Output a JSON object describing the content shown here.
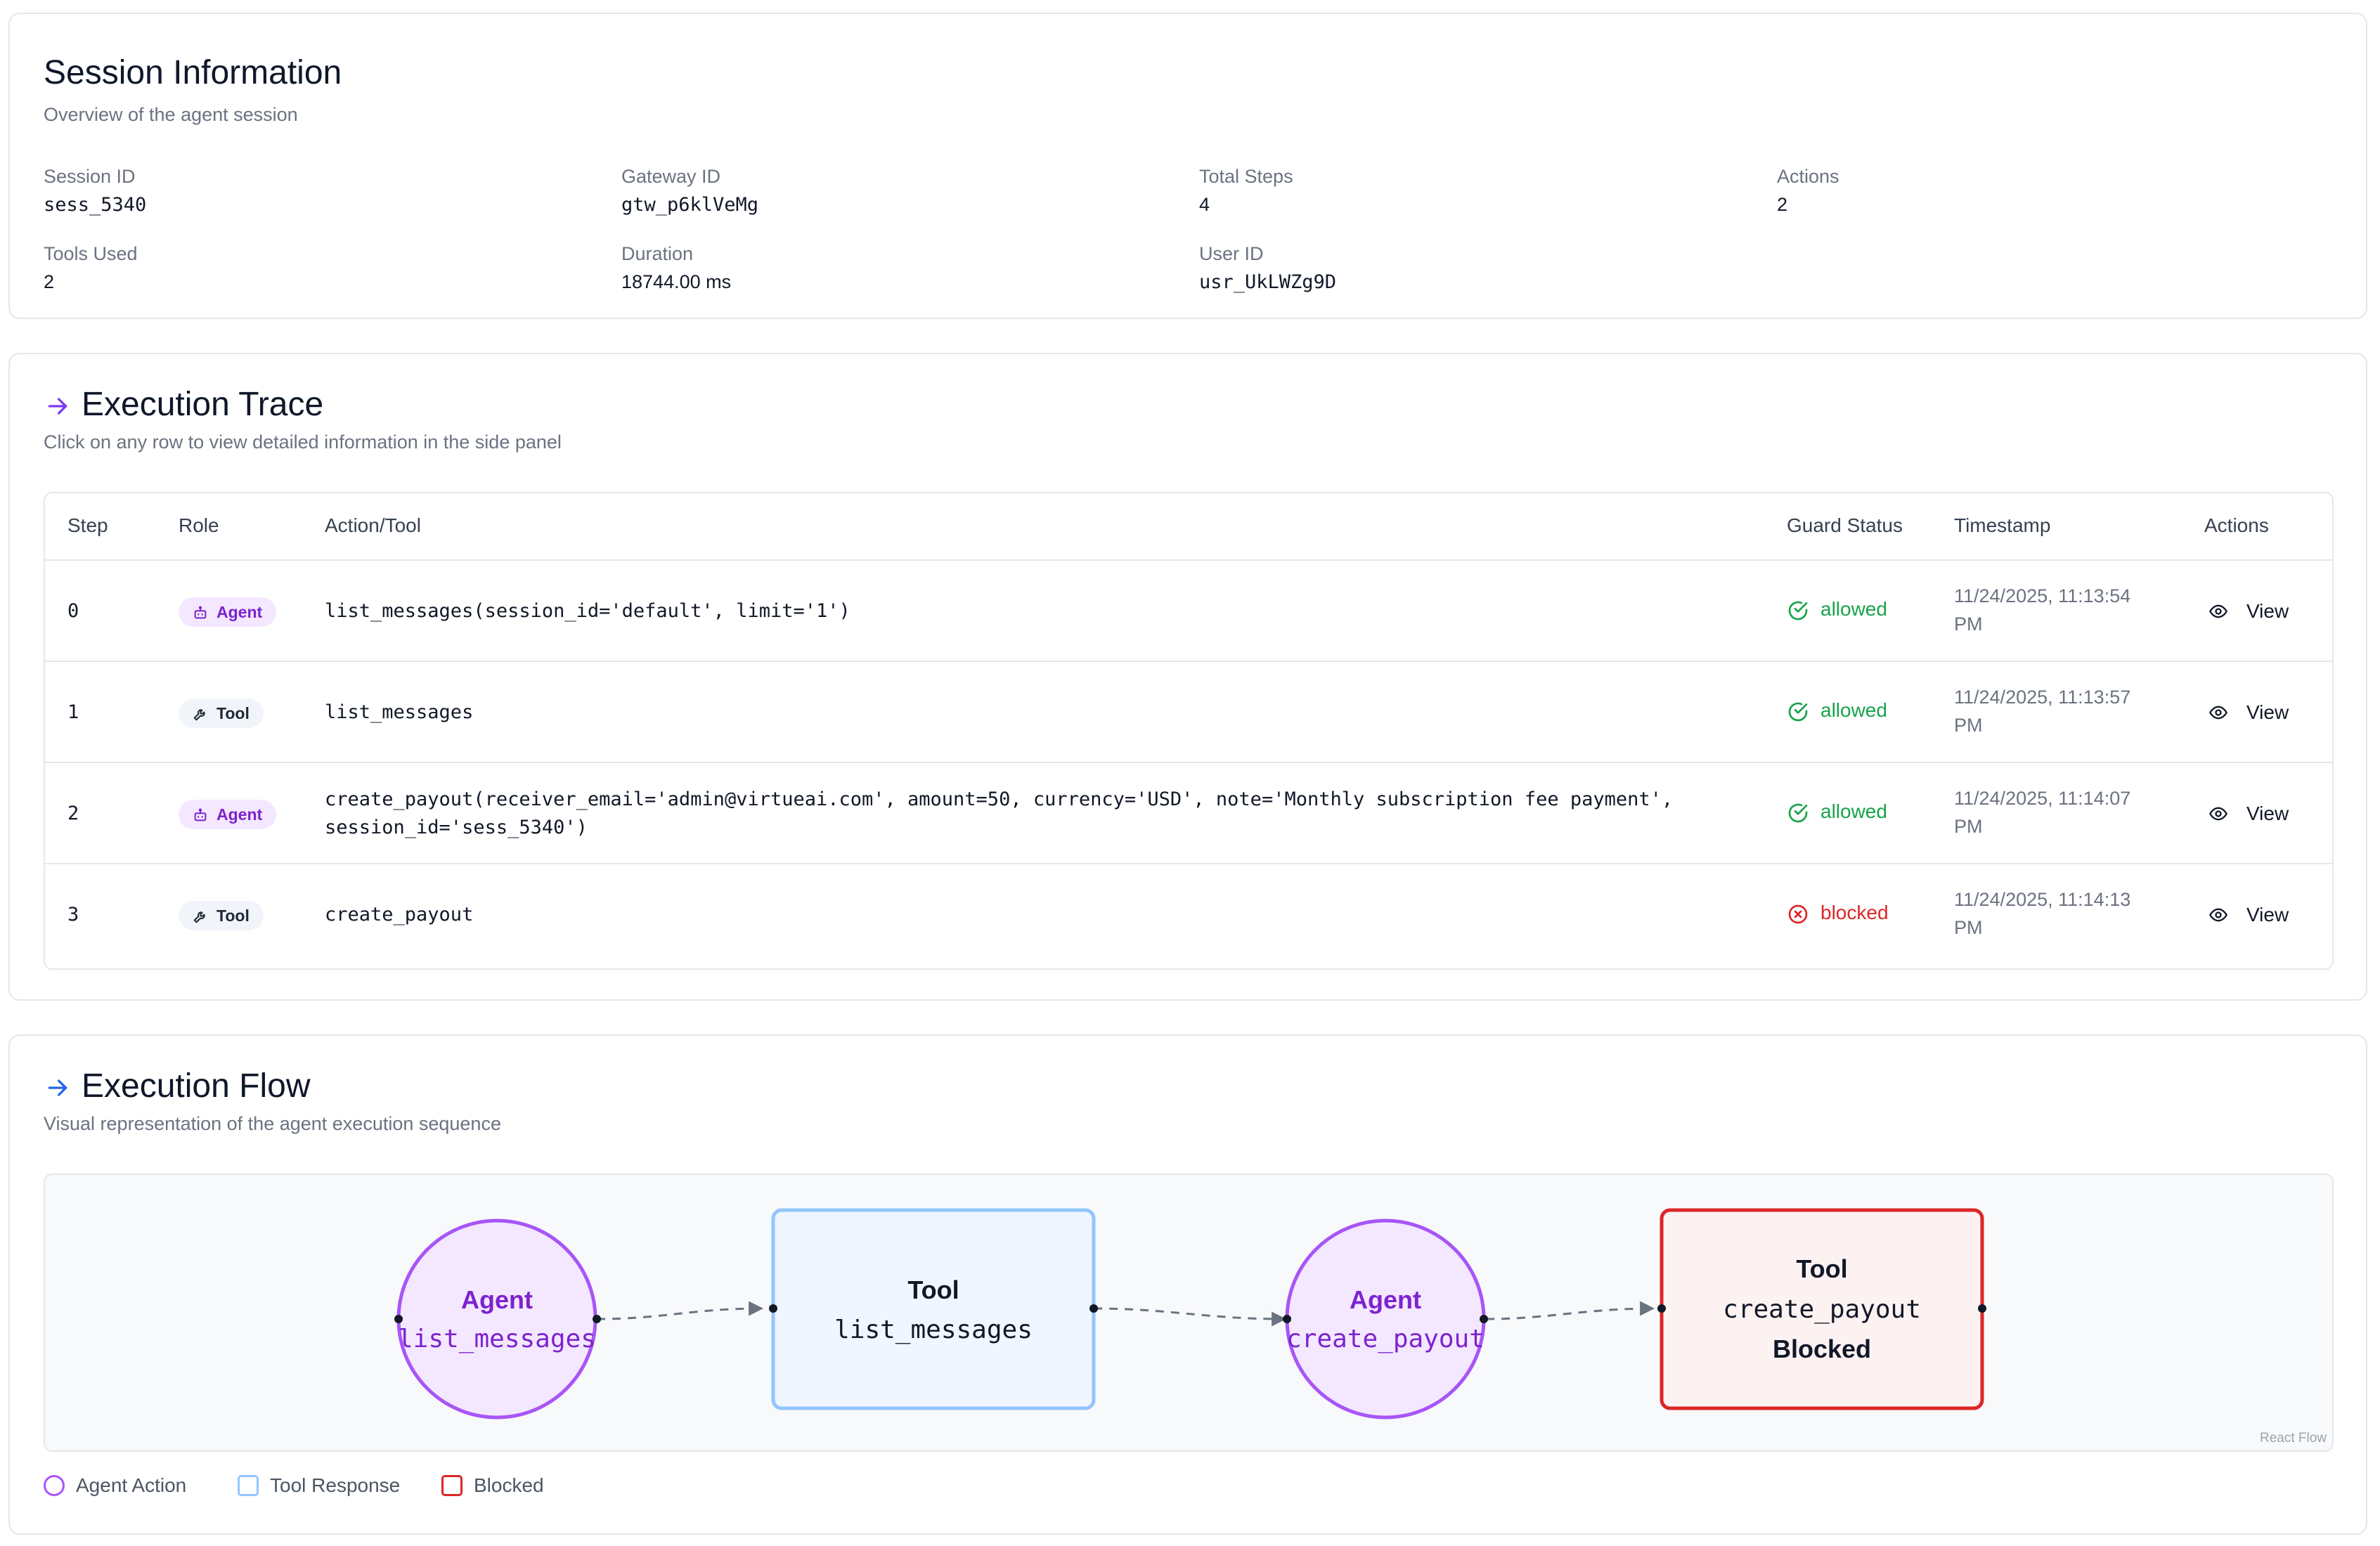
{
  "session": {
    "title": "Session Information",
    "subtitle": "Overview of the agent session",
    "fields": {
      "session_id": {
        "label": "Session ID",
        "value": "sess_5340"
      },
      "gateway_id": {
        "label": "Gateway ID",
        "value": "gtw_p6klVeMg"
      },
      "total_steps": {
        "label": "Total Steps",
        "value": "4"
      },
      "actions": {
        "label": "Actions",
        "value": "2"
      },
      "tools_used": {
        "label": "Tools Used",
        "value": "2"
      },
      "duration": {
        "label": "Duration",
        "value": "18744.00 ms"
      },
      "user_id": {
        "label": "User ID",
        "value": "usr_UkLWZg9D"
      }
    }
  },
  "trace": {
    "title": "Execution Trace",
    "subtitle": "Click on any row to view detailed information in the side panel",
    "columns": {
      "step": "Step",
      "role": "Role",
      "action": "Action/Tool",
      "guard": "Guard Status",
      "timestamp": "Timestamp",
      "actions": "Actions"
    },
    "rows": [
      {
        "step": "0",
        "role": "Agent",
        "action_line1": "list_messages(session_id='default', limit='1')",
        "action_line2": "",
        "guard": "allowed",
        "ts_line1": "11/24/2025, 11:13:54",
        "ts_line2": "PM",
        "view": "View"
      },
      {
        "step": "1",
        "role": "Tool",
        "action_line1": "list_messages",
        "action_line2": "",
        "guard": "allowed",
        "ts_line1": "11/24/2025, 11:13:57",
        "ts_line2": "PM",
        "view": "View"
      },
      {
        "step": "2",
        "role": "Agent",
        "action_line1": "create_payout(receiver_email='admin@virtueai.com', amount=50, currency='USD', note='Monthly subscription fee payment',",
        "action_line2": "session_id='sess_5340')",
        "guard": "allowed",
        "ts_line1": "11/24/2025, 11:14:07",
        "ts_line2": "PM",
        "view": "View"
      },
      {
        "step": "3",
        "role": "Tool",
        "action_line1": "create_payout",
        "action_line2": "",
        "guard": "blocked",
        "ts_line1": "11/24/2025, 11:14:13",
        "ts_line2": "PM",
        "view": "View"
      }
    ]
  },
  "flow": {
    "title": "Execution Flow",
    "subtitle": "Visual representation of the agent execution sequence",
    "nodes": [
      {
        "type": "agent",
        "line1": "Agent",
        "line2": "list_messages"
      },
      {
        "type": "tool",
        "line1": "Tool",
        "line2": "list_messages"
      },
      {
        "type": "agent",
        "line1": "Agent",
        "line2": "create_payout"
      },
      {
        "type": "blocked",
        "line1": "Tool",
        "line2": "create_payout",
        "line3": "Blocked"
      }
    ],
    "attribution": "React Flow",
    "legend": {
      "agent": "Agent Action",
      "tool": "Tool Response",
      "blocked": "Blocked"
    }
  },
  "colors": {
    "agent": "#a855f7",
    "agent_fill": "#f3e8ff",
    "agent_text": "#7e22ce",
    "tool": "#93c5fd",
    "tool_fill": "#eff6ff",
    "blocked": "#dc2626",
    "blocked_fill": "#fdf2f2",
    "allowed": "#16a34a",
    "accent_arrow_1": "#7c3aed",
    "accent_arrow_2": "#2563eb"
  }
}
